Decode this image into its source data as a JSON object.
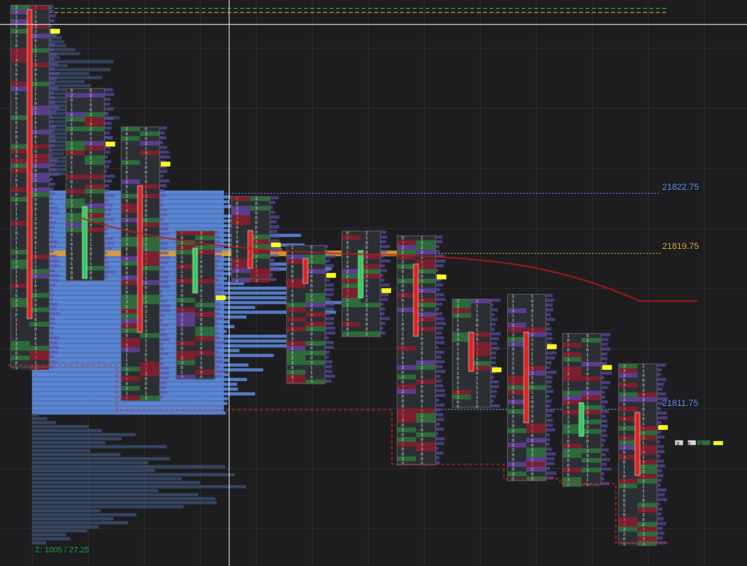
{
  "chart_data": {
    "type": "footprint",
    "price_levels": [
      {
        "label": "21822.75",
        "color": "#5b87d6"
      },
      {
        "label": "21819.75",
        "color": "#d0a13a"
      },
      {
        "label": "21811.75",
        "color": "#5b87d6"
      }
    ],
    "volume_summary": "Σ: 1005 / 27.25",
    "volume_summary_color": "#1f9a3a",
    "mini_readout": [
      "0",
      "0",
      "2"
    ],
    "colors": {
      "background": "#1d1d1f",
      "cell_neutral": "#2b2f33",
      "cell_buy": "#2c6a3a",
      "cell_sell": "#7a1f2e",
      "cell_purple": "#5a3c8c",
      "profile": "#5b87d6",
      "profile_dim": "#47618a",
      "poc": "#e0a234",
      "candle_up": "#2fcf5a",
      "candle_down": "#e0201f",
      "vwap": "#b71c1c",
      "marker": "#ffff1a",
      "dashed_green": "#2cbf6a",
      "dashed_orange": "#e0a234",
      "dashed_red": "#e02424"
    }
  }
}
